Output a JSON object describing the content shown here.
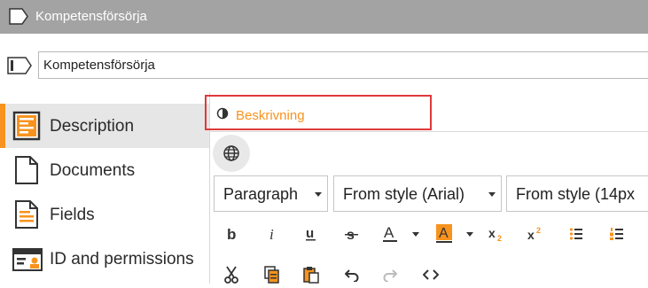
{
  "window": {
    "title": "Kompetensförsörja"
  },
  "name_field": {
    "value": "Kompetensförsörja"
  },
  "sidebar": {
    "items": [
      {
        "label": "Description",
        "icon": "description-icon",
        "active": true
      },
      {
        "label": "Documents",
        "icon": "document-icon",
        "active": false
      },
      {
        "label": "Fields",
        "icon": "fields-icon",
        "active": false
      },
      {
        "label": "ID and permissions",
        "icon": "id-card-icon",
        "active": false
      }
    ]
  },
  "content": {
    "language_label": "Beskrivning",
    "toolbar": {
      "block_format": "Paragraph",
      "font_family": "From style (Arial)",
      "font_size": "From style (14px"
    }
  },
  "colors": {
    "accent": "#f7931e",
    "highlight": "#e0393b",
    "titlebar": "#a3a3a3"
  }
}
